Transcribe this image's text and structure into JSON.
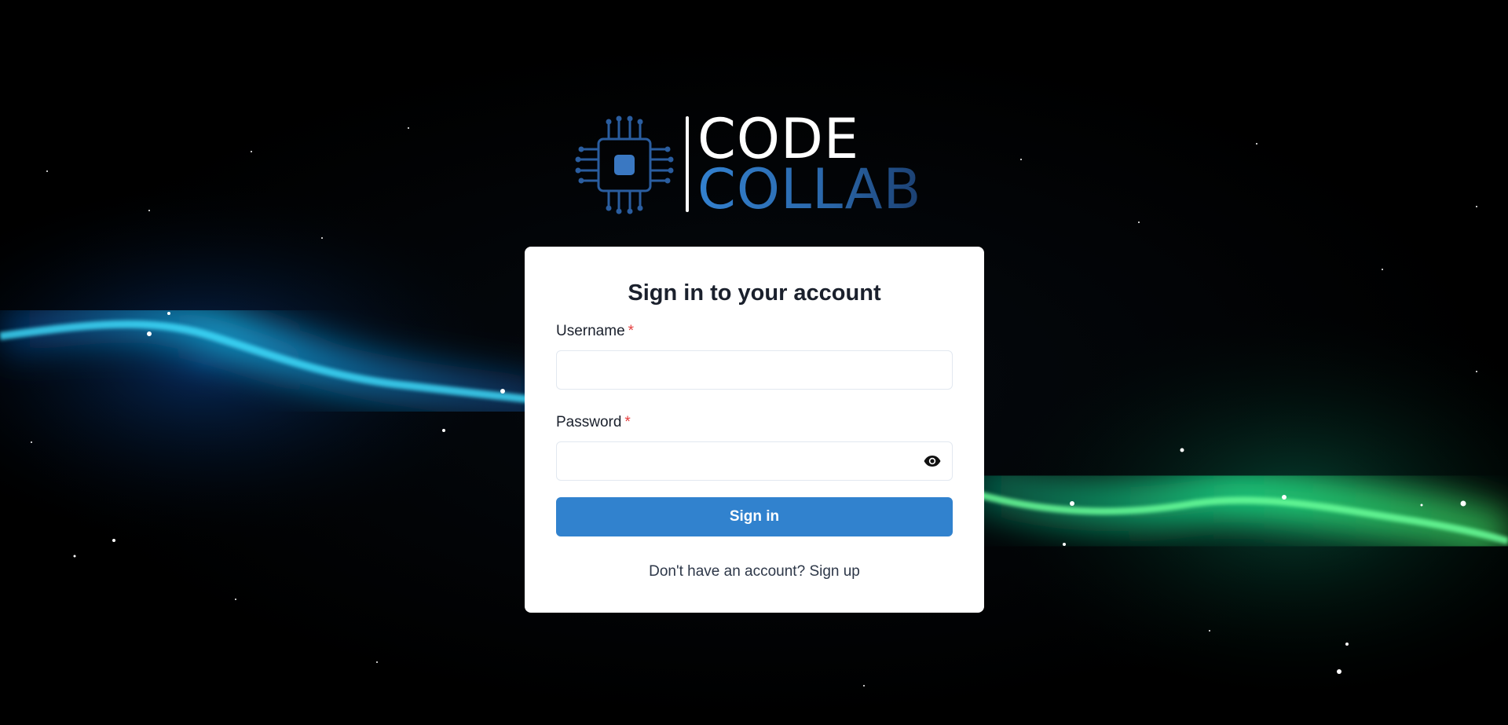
{
  "logo": {
    "line1": "CODE",
    "line2": "COLLAB",
    "icon": "circuit-chip-icon",
    "colors": {
      "line1": "#ffffff",
      "line2": "#3381cf"
    }
  },
  "login": {
    "title": "Sign in to your account",
    "username_label": "Username",
    "password_label": "Password",
    "required_marker": "*",
    "username_value": "",
    "password_value": "",
    "show_password_icon": "eye-icon",
    "submit_label": "Sign in",
    "signup_prompt": "Don't have an account?",
    "signup_link": "Sign up"
  },
  "colors": {
    "accent": "#3182ce",
    "required": "#e53e3e",
    "card_bg": "#ffffff",
    "page_bg": "#000000"
  }
}
